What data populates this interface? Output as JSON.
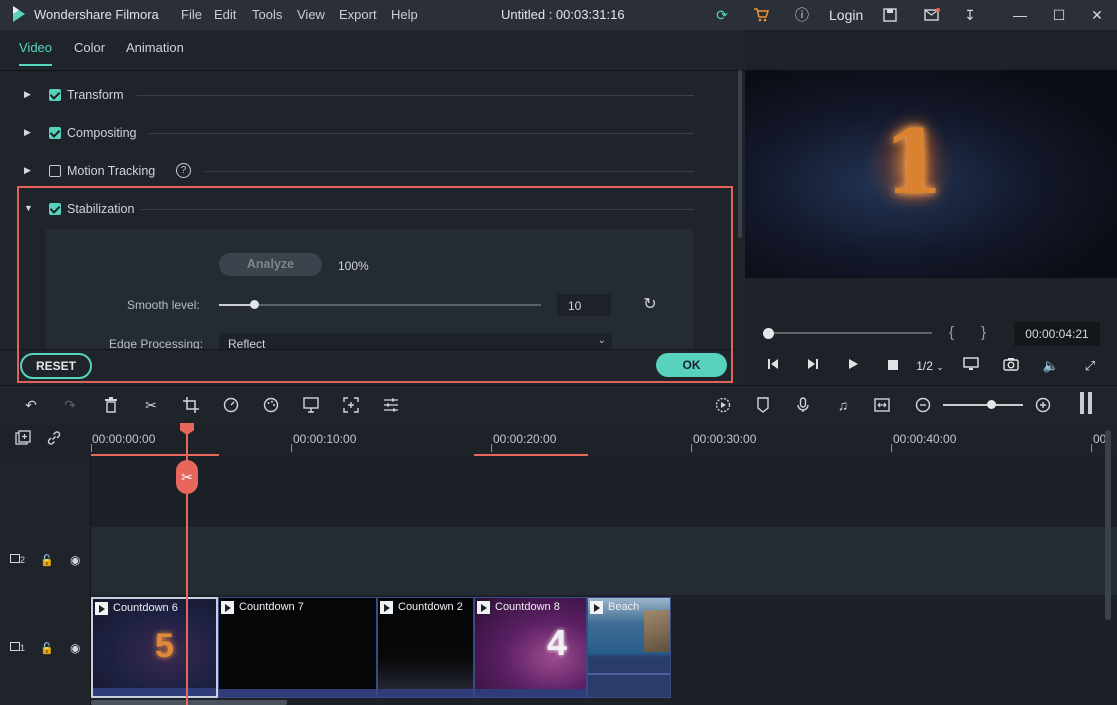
{
  "app": {
    "name": "Wondershare Filmora",
    "project_title": "Untitled : 00:03:31:16",
    "menu": [
      "File",
      "Edit",
      "Tools",
      "View",
      "Export",
      "Help"
    ],
    "login_label": "Login"
  },
  "tabs": [
    {
      "label": "Video",
      "active": true
    },
    {
      "label": "Color",
      "active": false
    },
    {
      "label": "Animation",
      "active": false
    }
  ],
  "sections": [
    {
      "label": "Transform",
      "checked": true,
      "expanded": false
    },
    {
      "label": "Compositing",
      "checked": true,
      "expanded": false
    },
    {
      "label": "Motion Tracking",
      "checked": false,
      "expanded": false
    },
    {
      "label": "Stabilization",
      "checked": true,
      "expanded": true
    }
  ],
  "stabilization": {
    "analyze_label": "Analyze",
    "analyze_progress": "100%",
    "smooth_label": "Smooth level:",
    "smooth_value": "10",
    "smooth_fraction": 0.11,
    "edge_label": "Edge Processing:",
    "edge_value": "Reflect"
  },
  "footer": {
    "reset_label": "RESET",
    "ok_label": "OK"
  },
  "preview": {
    "overlay_digit": "1",
    "timecode": "00:00:04:21",
    "brace_open": "{",
    "brace_close": "}",
    "quality": "1/2"
  },
  "ruler": {
    "labels": [
      "00:00:00:00",
      "00:00:10:00",
      "00:00:20:00",
      "00:00:30:00",
      "00:00:40:00",
      "00"
    ]
  },
  "tracks": [
    {
      "id": "track-2",
      "num": "2"
    },
    {
      "id": "track-1",
      "num": "1"
    }
  ],
  "clips": [
    {
      "name": "Countdown 6",
      "digit": "5"
    },
    {
      "name": "Countdown 7",
      "digit": ""
    },
    {
      "name": "Countdown 2",
      "digit": ""
    },
    {
      "name": "Countdown 8",
      "digit": "4"
    },
    {
      "name": "Beach",
      "digit": ""
    }
  ],
  "colors": {
    "accent": "#56d2bd",
    "highlight": "#e0635b",
    "playhead": "#e8675d"
  }
}
